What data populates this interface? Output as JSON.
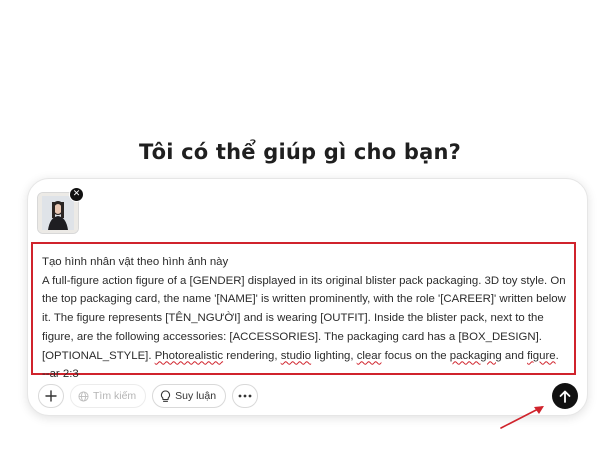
{
  "heading": "Tôi có thể giúp gì cho bạn?",
  "attachment": {
    "remove_symbol": "✕",
    "icon": "image-thumbnail"
  },
  "prompt": {
    "line1": "Tạo hình nhân vật theo hình ảnh này",
    "body_start": "A full-figure action figure of a [GENDER] displayed in its original blister pack packaging. 3D toy style. On the top packaging card, the name '[NAME]' is written prominently, with the role '[CAREER]' written below it. The figure represents [TÊN_NGƯỜI] and is wearing [OUTFIT]. Inside the blister pack, next to the figure, are the following accessories: [ACCESSORIES]. The packaging card has a [BOX_DESIGN]. [OPTIONAL_STYLE]. ",
    "w_photorealistic": "Photorealistic",
    "s1": " rendering, ",
    "w_studio": "studio",
    "s2": " lighting, ",
    "w_clear": "clear",
    "s3": " focus on the ",
    "w_packaging": "packaging",
    "s4": " and ",
    "w_figure": "figure",
    "s5": ".\n--ar 2:3"
  },
  "toolbar": {
    "add_icon": "plus-icon",
    "search_label": "Tìm kiếm",
    "reason_label": "Suy luận",
    "more_icon": "more-horizontal-icon"
  },
  "send": {
    "icon": "arrow-up-icon"
  },
  "colors": {
    "highlight": "#d0232c",
    "send_bg": "#111111",
    "text": "#2b2b2b"
  }
}
